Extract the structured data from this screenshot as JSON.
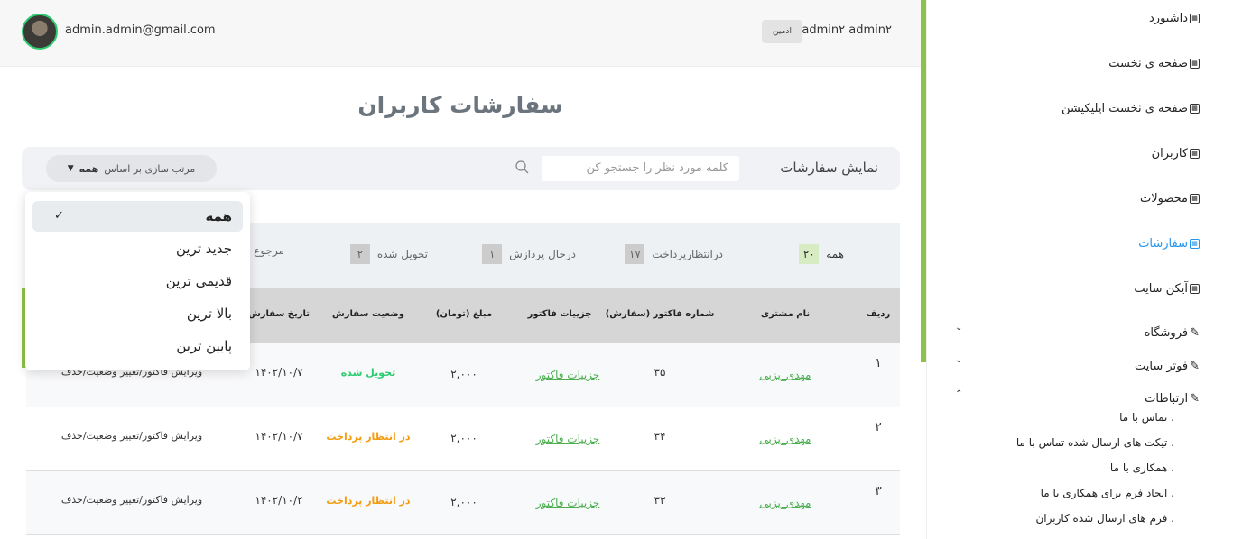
{
  "header": {
    "email": "admin.admin@gmail.com",
    "user_name": "admin۲ admin۲",
    "role_badge": "ادمین"
  },
  "page_title": "سفارشات کاربران",
  "toolbar": {
    "show_label": "نمایش سفارشات",
    "search_placeholder": "کلمه مورد نظر را جستجو کن",
    "sort_label": "مرتب سازی بر اساس",
    "sort_value": "همه"
  },
  "sort_options": [
    {
      "label": "همه",
      "selected": true
    },
    {
      "label": "جدید ترین"
    },
    {
      "label": "قدیمی ترین"
    },
    {
      "label": "بالا ترین"
    },
    {
      "label": "پایین ترین"
    }
  ],
  "tabs": [
    {
      "label": "همه",
      "count": "۲۰",
      "active": true
    },
    {
      "label": "درانتظارپرداخت",
      "count": "۱۷"
    },
    {
      "label": "درحال پردازش",
      "count": "۱"
    },
    {
      "label": "تحویل شده",
      "count": "۲"
    },
    {
      "label": "مرجوع ش"
    }
  ],
  "table": {
    "headers": [
      "ردیف",
      "نام مشتری",
      "شماره فاکتور (سفارش)",
      "جزییات فاکتور",
      "مبلغ (تومان)",
      "وضعیت سفارش",
      "تاریخ سفارش"
    ],
    "rows": [
      {
        "index": "۱",
        "customer": "مهدی_یزبی",
        "invoice": "۳۵",
        "details": "جزییات فاکتور",
        "amount": "۲,۰۰۰",
        "status": "تحویل شده",
        "status_type": "done",
        "date": "۱۴۰۲/۱۰/۷",
        "actions": "ویرایش فاکتور/تغییر وضعیت/حذف"
      },
      {
        "index": "۲",
        "customer": "مهدی_یزبی",
        "invoice": "۳۴",
        "details": "جزییات فاکتور",
        "amount": "۲,۰۰۰",
        "status": "در انتظار پرداخت",
        "status_type": "wait",
        "date": "۱۴۰۲/۱۰/۷",
        "actions": "ویرایش فاکتور/تغییر وضعیت/حذف"
      },
      {
        "index": "۳",
        "customer": "مهدی_یزبی",
        "invoice": "۳۳",
        "details": "جزییات فاکتور",
        "amount": "۲,۰۰۰",
        "status": "در انتظار پرداخت",
        "status_type": "wait",
        "date": "۱۴۰۲/۱۰/۲",
        "actions": "ویرایش فاکتور/تغییر وضعیت/حذف"
      }
    ]
  },
  "sidebar": {
    "items": [
      {
        "label": "داشبورد",
        "icon": "grid-icon"
      },
      {
        "label": "صفحه ی نخست",
        "icon": "grid-icon"
      },
      {
        "label": "صفحه ی نخست اپلیکیشن",
        "icon": "grid-icon"
      },
      {
        "label": "کاربران",
        "icon": "grid-icon"
      },
      {
        "label": "محصولات",
        "icon": "grid-icon"
      },
      {
        "label": "سفارشات",
        "icon": "grid-icon",
        "active": true
      },
      {
        "label": "آیکن سایت",
        "icon": "grid-icon"
      },
      {
        "label": "فروشگاه",
        "icon": "pen-icon"
      },
      {
        "label": "فوتر سایت",
        "icon": "pen-icon"
      },
      {
        "label": "ارتباطات",
        "icon": "pen-icon"
      }
    ],
    "sub_items": [
      ". تماس با ما",
      ". تیکت های ارسال شده تماس با ما",
      ". همکاری با ما",
      ". ایجاد فرم برای همکاری با ما",
      ". فرم های ارسال شده کاربران"
    ]
  },
  "colors": {
    "accent": "#8bc34a",
    "active_link": "#2196f3",
    "status_done": "#2ecc71",
    "status_wait": "#f39c12"
  }
}
